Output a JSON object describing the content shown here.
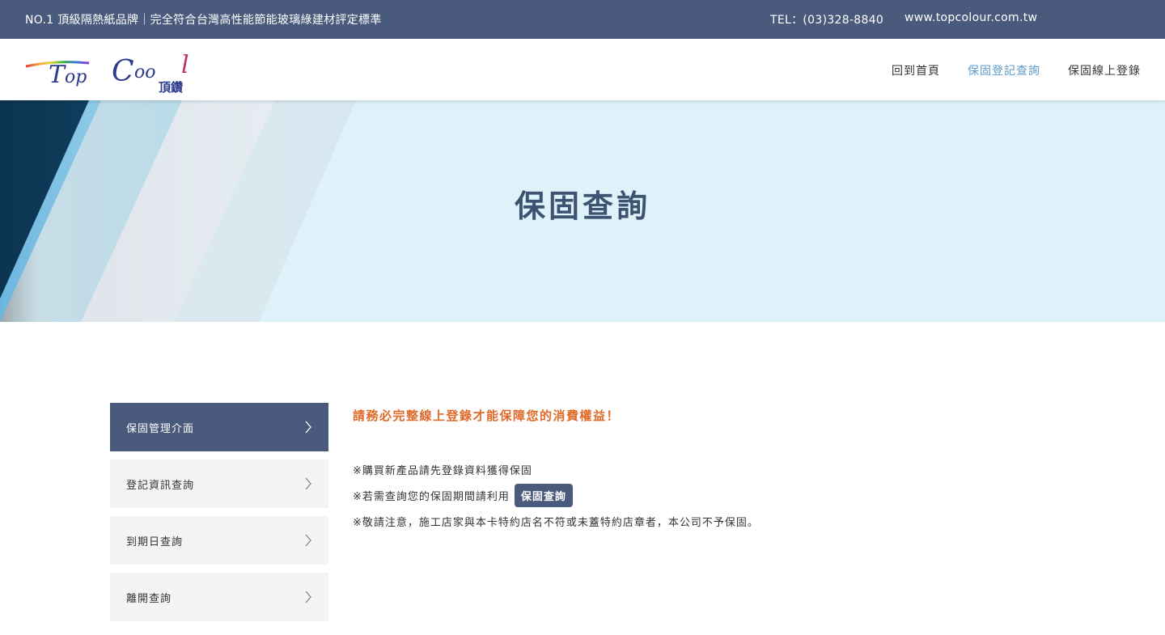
{
  "topbar": {
    "slogan": "NO.1 頂級隔熱紙品牌｜完全符合台灣高性能節能玻璃綠建材評定標準",
    "tel": "TEL：(03)328-8840",
    "website": "www.topcolour.com.tw"
  },
  "header": {
    "logo_text": "TopCool",
    "logo_sub": "頂鑽",
    "nav": [
      {
        "label": "回到首頁"
      },
      {
        "label": "保固登記查詢"
      },
      {
        "label": "保固線上登錄"
      }
    ]
  },
  "banner": {
    "title": "保固查詢"
  },
  "sidebar": {
    "items": [
      {
        "label": "保固管理介面"
      },
      {
        "label": "登記資訊查詢"
      },
      {
        "label": "到期日查詢"
      },
      {
        "label": "離開查詢"
      }
    ]
  },
  "main": {
    "notice": "請務必完整線上登錄才能保障您的消費權益！",
    "line1": "※購買新產品請先登錄資料獲得保固",
    "line2": "※若需查詢您的保固期間請利用",
    "query_button": "保固查詢",
    "line3": "※敬請注意，施工店家與本卡特約店名不符或未蓋特約店章者，本公司不予保固。"
  },
  "colors": {
    "topbar": "#4a5a7c",
    "nav_active": "#5b9bc9",
    "notice": "#e06a2a",
    "banner_bg": "#def2f9",
    "banner_title": "#3e5372"
  }
}
